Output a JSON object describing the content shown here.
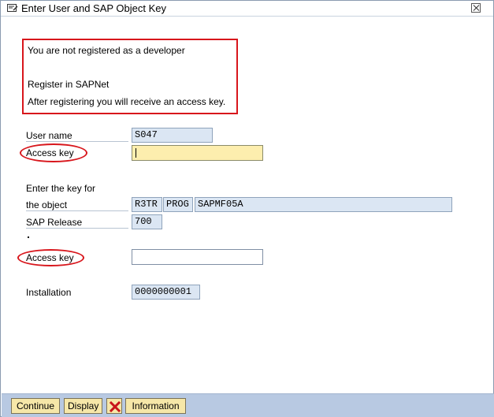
{
  "window": {
    "title": "Enter User and SAP Object Key"
  },
  "message": {
    "line1": "You are not registered as a developer",
    "line2": "Register in SAPNet",
    "line3": "After registering you will receive an access key."
  },
  "user": {
    "name_label": "User name",
    "name_value": "S047",
    "access_key_label": "Access key",
    "access_key_value": ""
  },
  "object": {
    "enter_key_label": "Enter the key for",
    "object_label": "the object",
    "pgmid": "R3TR",
    "type": "PROG",
    "name": "SAPMF05A",
    "release_label": "SAP Release",
    "release_value": "700",
    "dot": ".",
    "access_key_label": "Access key",
    "access_key_value": ""
  },
  "installation": {
    "label": "Installation",
    "value": "0000000001"
  },
  "footer": {
    "continue_label": "Continue",
    "display_label": "Display",
    "information_label": "Information"
  },
  "colors": {
    "highlight_red": "#d8161c",
    "field_readonly": "#dbe6f3",
    "field_focus": "#fdeeae",
    "footer_bg": "#b8c9e2",
    "button_bg": "#f6e7a8"
  },
  "icons": {
    "title": "key-dialog-icon",
    "close": "close-icon",
    "cancel": "cancel-x-icon"
  }
}
